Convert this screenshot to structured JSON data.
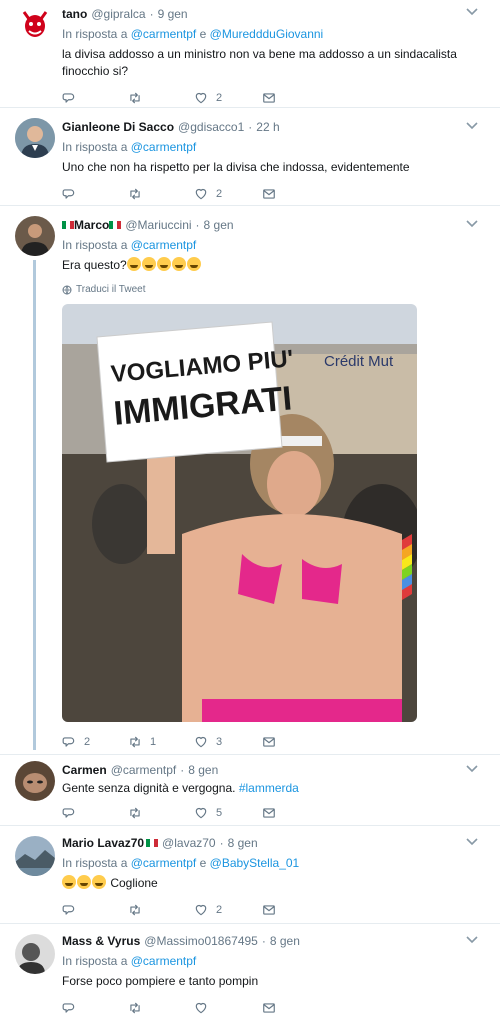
{
  "tweets": [
    {
      "name": "tano",
      "handle": "@gipralca",
      "time": "9 gen",
      "reply_prefix": "In risposta a",
      "reply_to_1": "@carmentpf",
      "reply_and": "e",
      "reply_to_2": "@MureddduGiovanni",
      "text_1": "la divisa addosso a un ministro non va bene ma addosso a un sindacalista",
      "text_2": "finocchio si?",
      "likes": "2"
    },
    {
      "name": "Gianleone Di Sacco",
      "handle": "@gdisacco1",
      "time": "22 h",
      "reply_prefix": "In risposta a",
      "reply_to_1": "@carmentpf",
      "text_1": "Uno che non ha rispetto per la divisa che indossa, evidentemente",
      "likes": "2"
    },
    {
      "name": "Marco",
      "handle": "@Mariuccini",
      "time": "8 gen",
      "reply_prefix": "In risposta a",
      "reply_to_1": "@carmentpf",
      "text_1": "Era questo?",
      "translate": "Traduci il Tweet",
      "image_sign_line1": "VOGLIAMO PIU'",
      "image_sign_line2": "IMMIGRATI",
      "image_bg_sign": "Crédit Mut",
      "replies": "2",
      "retweets": "1",
      "likes": "3"
    },
    {
      "name": "Carmen",
      "handle": "@carmentpf",
      "time": "8 gen",
      "text_1": "Gente senza dignità e vergogna.",
      "hashtag": "#lammerda",
      "likes": "5"
    },
    {
      "name": "Mario Lavaz70",
      "handle": "@lavaz70",
      "time": "8 gen",
      "reply_prefix": "In risposta a",
      "reply_to_1": "@carmentpf",
      "reply_and": "e",
      "reply_to_2": "@BabyStella_01",
      "text_1": "Coglione",
      "likes": "2"
    },
    {
      "name": "Mass & Vyrus",
      "handle": "@Massimo01867495",
      "time": "8 gen",
      "reply_prefix": "In risposta a",
      "reply_to_1": "@carmentpf",
      "text_1": "Forse poco pompiere e tanto pompin"
    }
  ],
  "colors": {
    "link": "#1b95e0",
    "muted": "#657786",
    "thread": "#b1c9dc"
  },
  "icons": [
    "reply-icon",
    "retweet-icon",
    "like-icon",
    "dm-icon",
    "caret-down-icon",
    "globe-icon"
  ]
}
